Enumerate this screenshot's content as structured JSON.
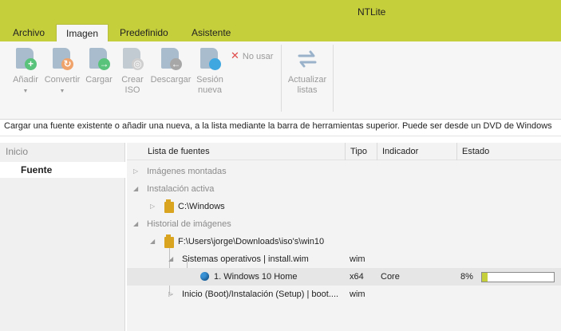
{
  "app": {
    "title": "NTLite"
  },
  "menu": {
    "tabs": [
      "Archivo",
      "Imagen",
      "Predefinido",
      "Asistente"
    ],
    "active": "Imagen"
  },
  "ribbon": {
    "add": "Añadir",
    "convert": "Convertir",
    "load": "Cargar",
    "create_iso": "Crear ISO",
    "download": "Descargar",
    "new_session": "Sesión nueva",
    "no_quit": "No usar",
    "refresh_lists": "Actualizar listas"
  },
  "info": "Cargar una fuente existente o añadir una nueva, a la lista mediante la barra de herramientas superior. Puede ser desde un DVD de Windows",
  "sidebar": {
    "header": "Inicio",
    "item": "Fuente"
  },
  "table": {
    "columns": [
      "Lista de fuentes",
      "Tipo",
      "Indicador",
      "Estado"
    ],
    "groups": {
      "mounted": "Imágenes montadas",
      "active_install": "Instalación activa",
      "active_path": "C:\\Windows",
      "history": "Historial de imágenes",
      "history_path": "F:\\Users\\jorge\\Downloads\\iso's\\win10"
    },
    "rows": [
      {
        "name": "Sistemas operativos  |  install.wim",
        "type": "wim",
        "flag": "",
        "status": ""
      },
      {
        "name": "1. Windows 10 Home",
        "type": "x64",
        "flag": "Core",
        "status": "8%"
      },
      {
        "name": "Inicio (Boot)/Instalación (Setup)  |  boot....",
        "type": "wim",
        "flag": "",
        "status": ""
      }
    ],
    "progress_fraction": 0.08
  },
  "colors": {
    "accent": "#c5ce3b",
    "folder": "#d9a521",
    "dot": "#3a93d6"
  }
}
